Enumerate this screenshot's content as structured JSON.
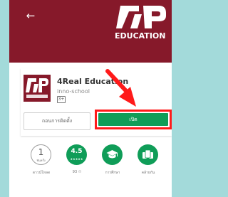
{
  "banner": {
    "back_icon": "arrow-left-icon",
    "brand_text": "EDUCATION",
    "color": "#86192a"
  },
  "app": {
    "title": "4Real Education",
    "developer": "inno-school",
    "content_rating_badge": "3+",
    "uninstall_label": "ถอนการติดตั้ง",
    "open_label": "เปิด",
    "accent_color": "#0f9d58",
    "highlight_color": "#ff1a1a"
  },
  "stats": {
    "downloads": {
      "number": "1",
      "unit": "พันครั้ง",
      "label": "ดาวน์โหลด"
    },
    "rating": {
      "value": "4.5",
      "stars": "★★★★★",
      "label": "93 ⚇"
    },
    "category": {
      "icon": "graduation-cap-icon",
      "label": "การศึกษา"
    },
    "similar": {
      "icon": "similar-apps-icon",
      "label": "คล้ายกัน"
    }
  }
}
